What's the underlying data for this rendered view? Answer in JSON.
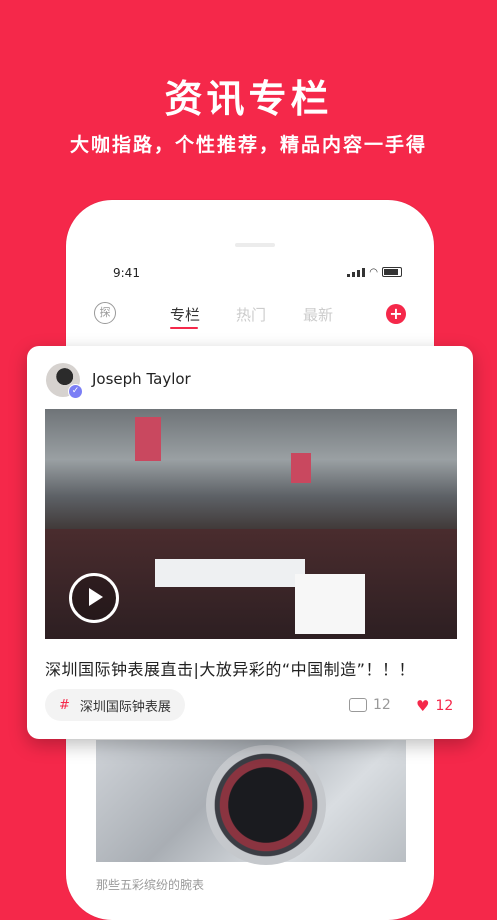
{
  "promo": {
    "title": "资讯专栏",
    "subtitle": "大咖指路，个性推荐，精品内容一手得"
  },
  "phone": {
    "status_time": "9:41",
    "tabs": [
      {
        "label": "专栏",
        "active": true
      },
      {
        "label": "热门",
        "active": false
      },
      {
        "label": "最新",
        "active": false
      }
    ],
    "search_icon_glyph": "探",
    "add_icon_glyph": "+",
    "background_caption": "那些五彩缤纷的腕表"
  },
  "card": {
    "author": "Joseph Taylor",
    "headline": "深圳国际钟表展直击|大放异彩的“中国制造”！！！",
    "tag_hash": "#",
    "tag": "深圳国际钟表展",
    "comments": "12",
    "likes": "12"
  },
  "colors": {
    "accent": "#f5284a",
    "verified_badge": "#7b7ef5"
  }
}
